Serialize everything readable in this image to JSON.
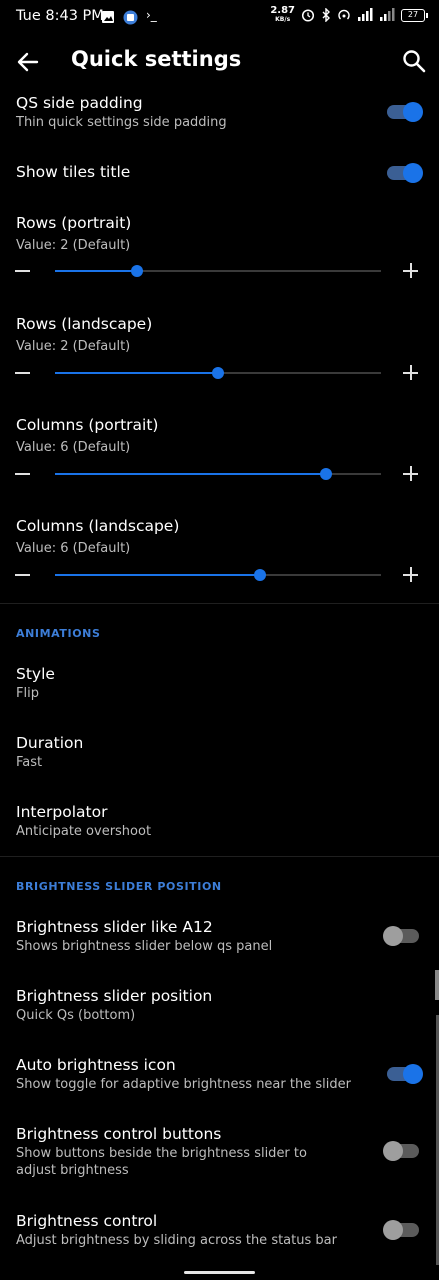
{
  "status_bar": {
    "time": "Tue 8:43 PM",
    "net_speed": "2.87",
    "net_unit": "KB/s",
    "battery": "27"
  },
  "app_bar": {
    "title": "Quick settings"
  },
  "settings": {
    "qs_padding": {
      "title": "QS side padding",
      "summary": "Thin quick settings side padding",
      "enabled": true
    },
    "tiles_title": {
      "title": "Show tiles title",
      "enabled": true
    },
    "rows_portrait": {
      "title": "Rows (portrait)",
      "value_text": "Value: 2  (Default)",
      "level": 0.25
    },
    "rows_landscape": {
      "title": "Rows (landscape)",
      "value_text": "Value: 2  (Default)",
      "level": 0.5
    },
    "cols_portrait": {
      "title": "Columns (portrait)",
      "value_text": "Value: 6  (Default)",
      "level": 0.83
    },
    "cols_landscape": {
      "title": "Columns (landscape)",
      "value_text": "Value: 6  (Default)",
      "level": 0.63
    }
  },
  "animations": {
    "header": "ANIMATIONS",
    "style": {
      "title": "Style",
      "summary": "Flip"
    },
    "duration": {
      "title": "Duration",
      "summary": "Fast"
    },
    "interpolator": {
      "title": "Interpolator",
      "summary": "Anticipate overshoot"
    }
  },
  "brightness": {
    "header": "BRIGHTNESS SLIDER POSITION",
    "like_a12": {
      "title": "Brightness slider like A12",
      "summary": "Shows brightness slider below qs panel",
      "enabled": false
    },
    "position": {
      "title": "Brightness slider position",
      "summary": "Quick Qs (bottom)"
    },
    "auto_icon": {
      "title": "Auto brightness icon",
      "summary": "Show toggle for adaptive brightness near the slider",
      "enabled": true
    },
    "control_buttons": {
      "title": "Brightness control buttons",
      "summary": "Show buttons beside the brightness slider to adjust brightness",
      "enabled": false
    },
    "control": {
      "title": "Brightness control",
      "summary": "Adjust brightness by sliding across the status bar",
      "enabled": false
    }
  },
  "colors": {
    "accent": "#1a73e8",
    "section_header": "#3d7ed8",
    "background": "#000000"
  }
}
